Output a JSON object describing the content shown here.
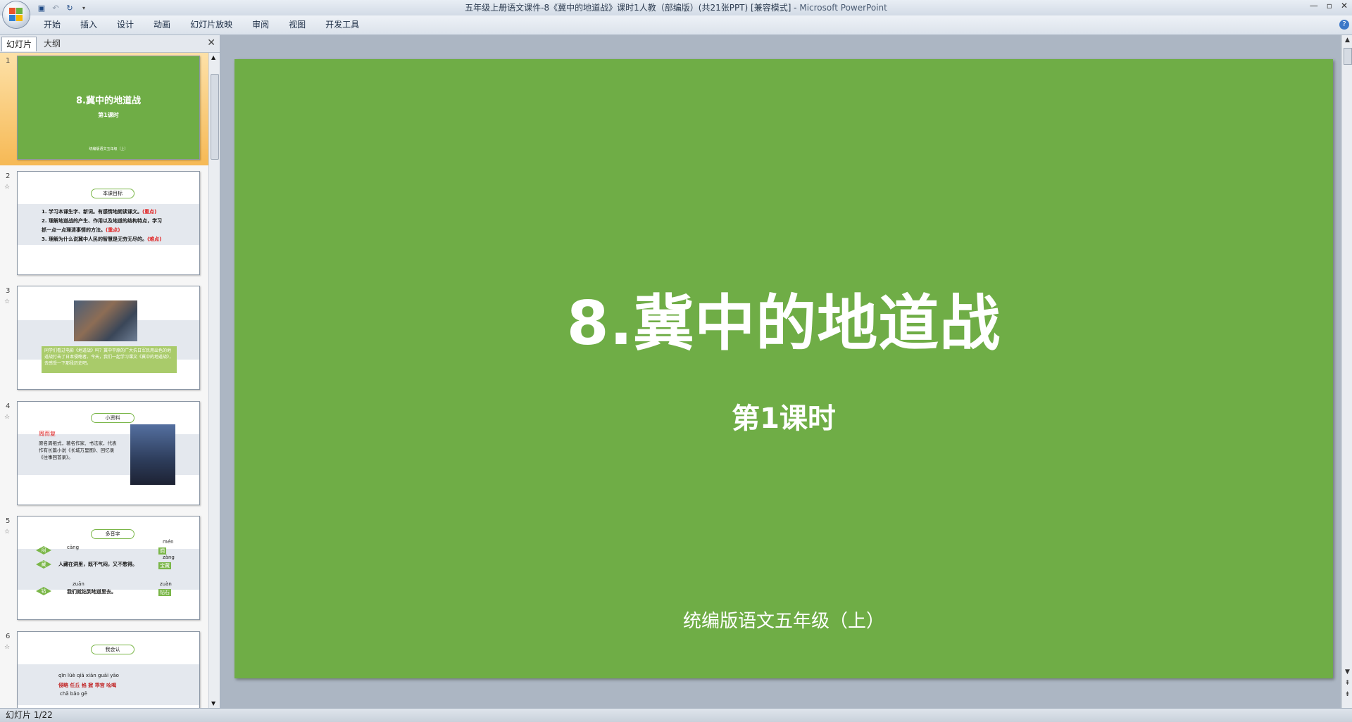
{
  "window": {
    "title": "五年级上册语文课件-8《冀中的地道战》课时1人教（部编版）(共21张PPT) [兼容模式] - ",
    "app_name": "Microsoft PowerPoint"
  },
  "ribbon": {
    "tabs": [
      "开始",
      "插入",
      "设计",
      "动画",
      "幻灯片放映",
      "审阅",
      "视图",
      "开发工具"
    ]
  },
  "left_pane": {
    "tab_slides": "幻灯片",
    "tab_outline": "大纲"
  },
  "thumbnails": [
    {
      "num": "1",
      "title": "8.冀中的地道战",
      "subtitle": "第1课时",
      "footer": "统编版语文五年级（上）"
    },
    {
      "num": "2",
      "pill": "本课目标",
      "lines": [
        {
          "text": "1. 学习本课生字、新词。有感情地朗读课文。",
          "tag": "(重点)"
        },
        {
          "text": "2. 理解地道战的产生、作用以及地道的结构特点，学习",
          "tag": ""
        },
        {
          "text": "抓一点一点理清事情的方法。",
          "tag": "(重点)"
        },
        {
          "text": "3. 理解为什么说冀中人民的智慧是无穷无尽的。",
          "tag": "(难点)"
        }
      ]
    },
    {
      "num": "3",
      "caption": "同学们看过电影《地道战》吗？冀中平原的广大抗日军民用出色的地道战打击了日本侵略者。今天，我们一起学习课文《冀中的地道战》，去感受一下那段历史吧。"
    },
    {
      "num": "4",
      "pill": "小资料",
      "name": "周而复",
      "bio": "原名周祖式，著名作家、书法家，代表作有长篇小说《长城万里图》、回忆录《往事回首录》。"
    },
    {
      "num": "5",
      "pill": "多音字",
      "rows": [
        {
          "d": "闷",
          "p1": "cāng",
          "p2": "mén",
          "w": "藏",
          "t": "燜"
        },
        {
          "d": "藏",
          "p1": "",
          "p2": "zàng",
          "w": "人藏在洞里，既不气闷，又不憋得。",
          "t": "宝藏"
        },
        {
          "d": "钻",
          "p1": "zuān",
          "p2": "zuàn",
          "w": "我们就钻到地道里去。",
          "t": "钻石"
        }
      ]
    },
    {
      "num": "6",
      "pill": "我会认",
      "pinyin1": "qīn lüè   qiā   xiān   guāi  yāo",
      "words1": "侵略  任丘  掐  掀  乖宫  吆喝",
      "pinyin2": "chā  bǎo   gē"
    }
  ],
  "slide": {
    "title": "8.冀中的地道战",
    "subtitle": "第1课时",
    "footer": "统编版语文五年级（上）"
  },
  "status": {
    "slide_indicator": "幻灯片 1/22"
  },
  "colors": {
    "slide_green": "#6fad46",
    "selection_orange": "#f6b955"
  }
}
